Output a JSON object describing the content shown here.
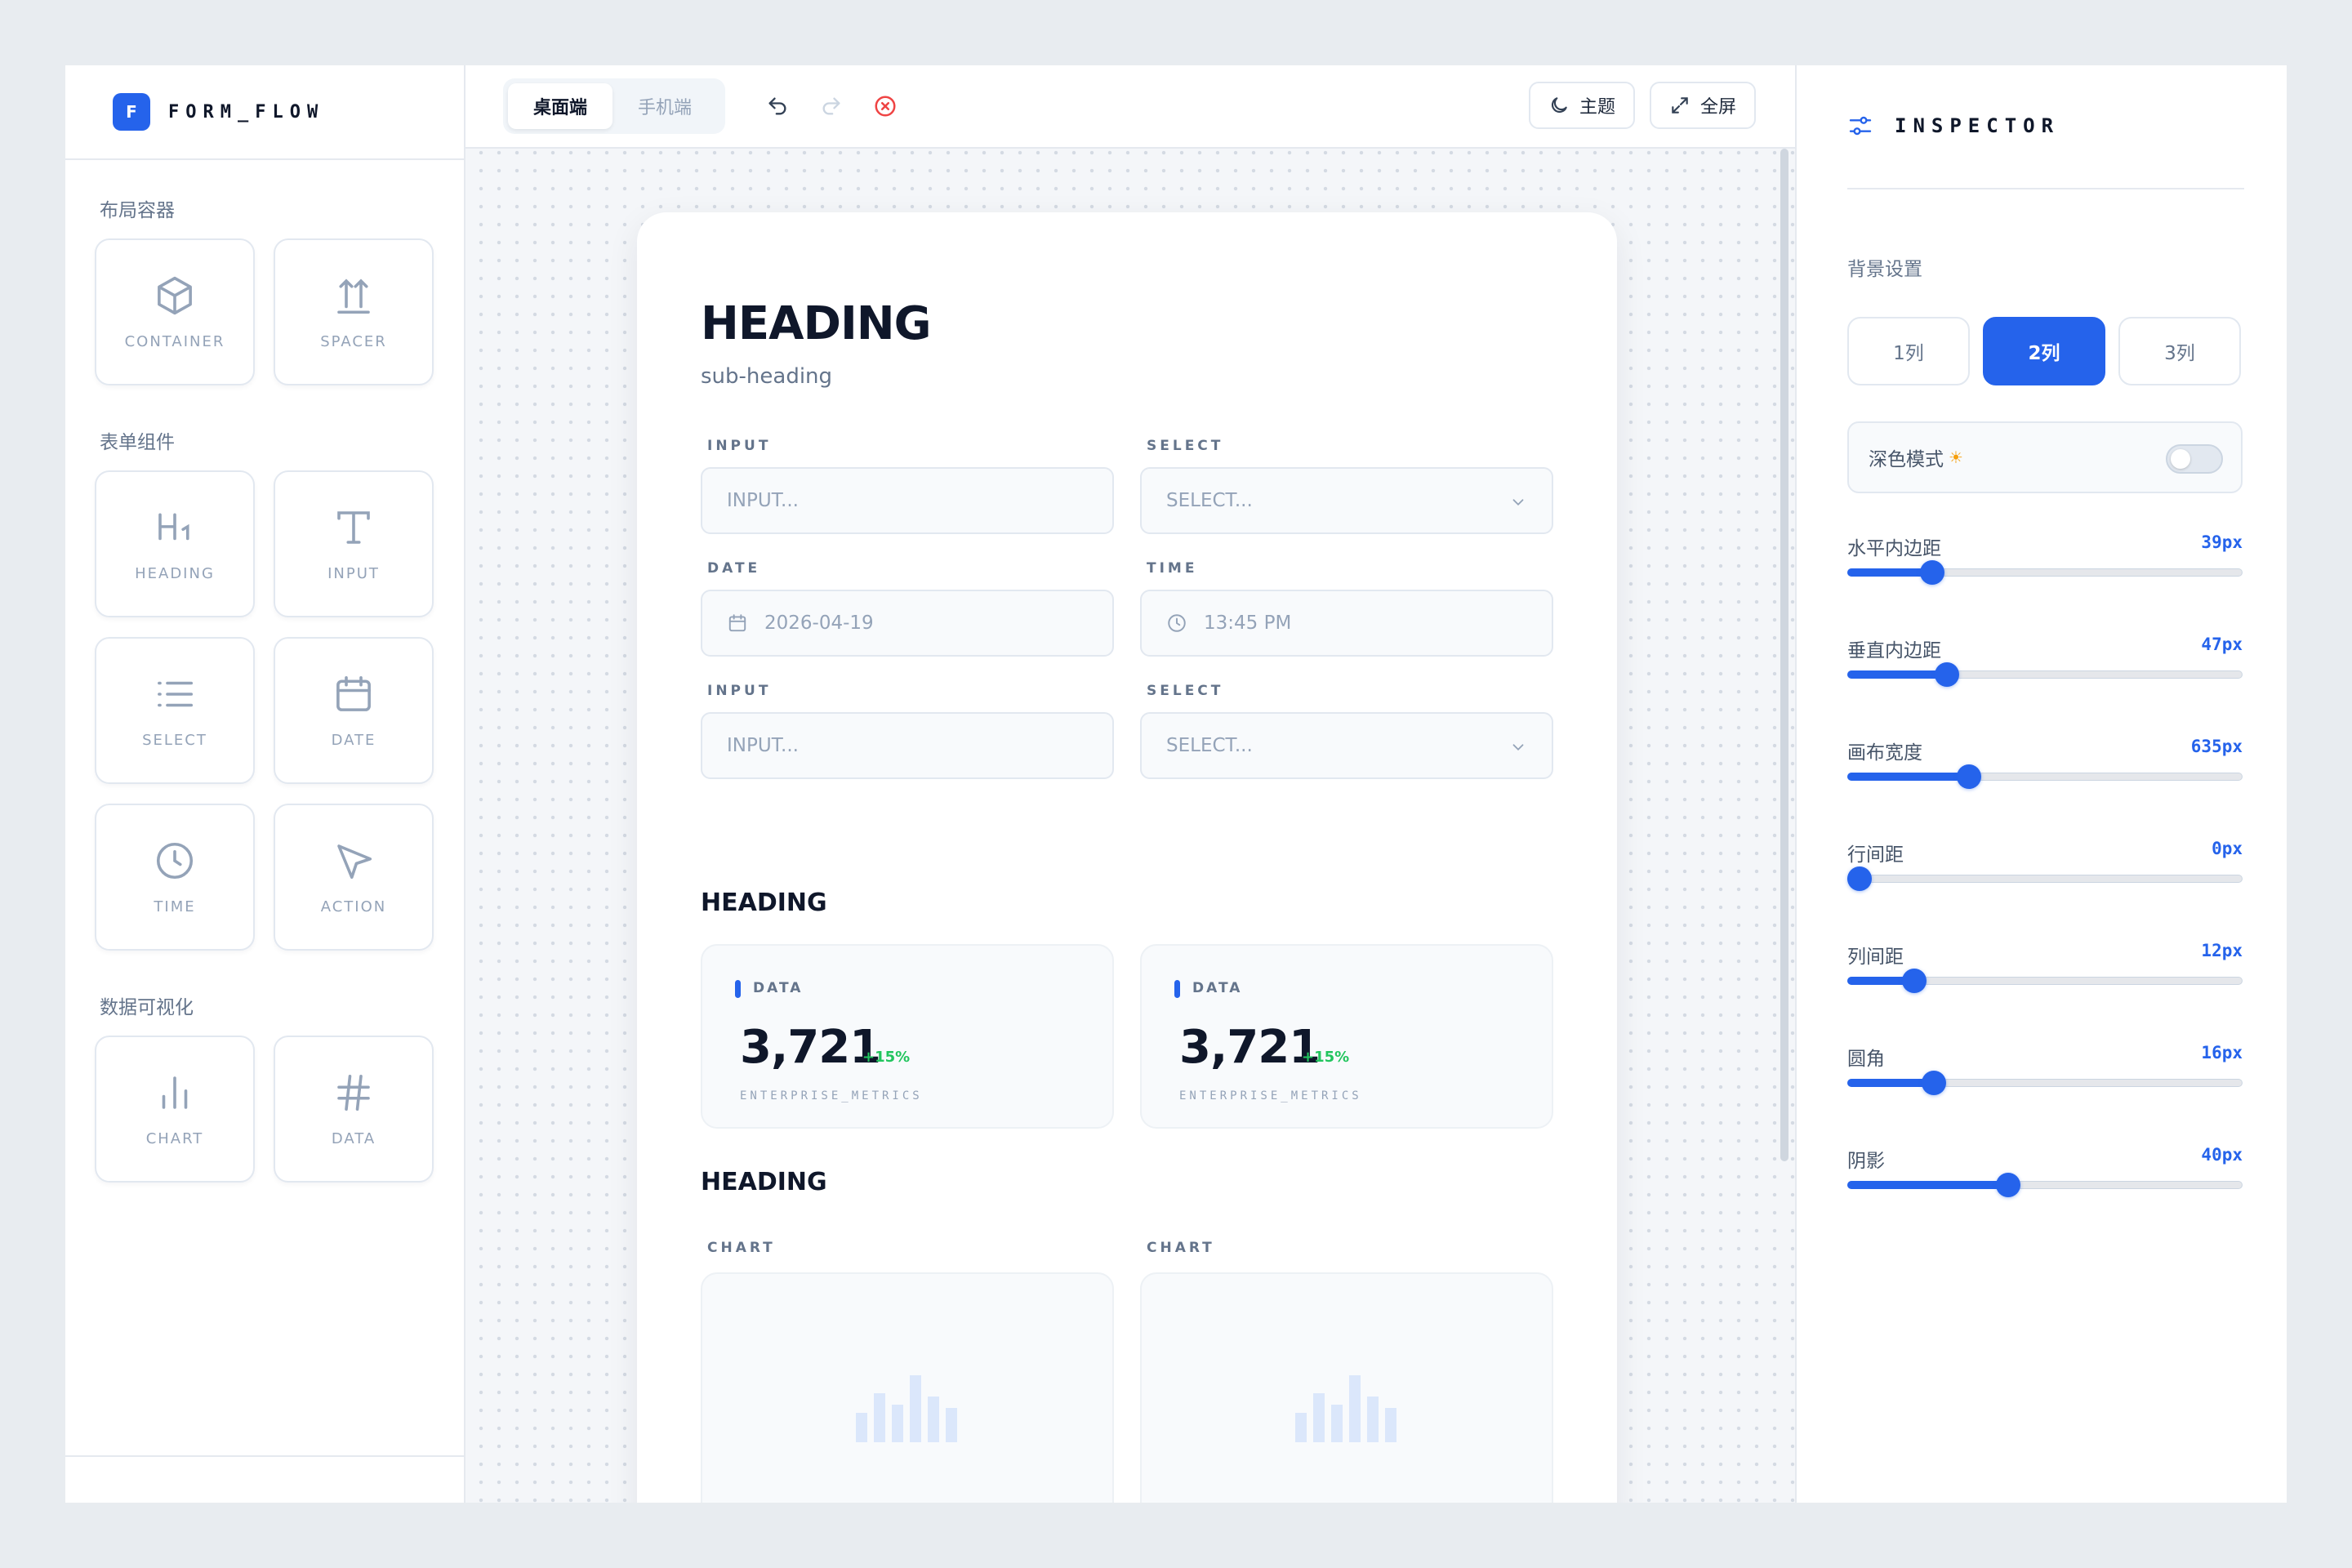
{
  "brand": {
    "logo_letter": "F",
    "name": "FORM_FLOW"
  },
  "palette": {
    "sections": [
      {
        "title": "布局容器",
        "items": [
          {
            "label": "CONTAINER",
            "icon": "box-icon"
          },
          {
            "label": "SPACER",
            "icon": "spacer-icon"
          }
        ]
      },
      {
        "title": "表单组件",
        "items": [
          {
            "label": "HEADING",
            "icon": "heading-icon"
          },
          {
            "label": "INPUT",
            "icon": "text-icon"
          },
          {
            "label": "SELECT",
            "icon": "list-icon"
          },
          {
            "label": "DATE",
            "icon": "calendar-icon"
          },
          {
            "label": "TIME",
            "icon": "clock-icon"
          },
          {
            "label": "ACTION",
            "icon": "cursor-icon"
          }
        ]
      },
      {
        "title": "数据可视化",
        "items": [
          {
            "label": "CHART",
            "icon": "bar-chart-icon"
          },
          {
            "label": "DATA",
            "icon": "hash-icon"
          }
        ]
      }
    ]
  },
  "toolbar": {
    "device_tabs": [
      {
        "label": "桌面端",
        "active": true
      },
      {
        "label": "手机端",
        "active": false
      }
    ],
    "theme_label": "主题",
    "fullscreen_label": "全屏"
  },
  "canvas": {
    "heading": "HEADING",
    "subheading": "sub-heading",
    "fields": [
      {
        "label": "INPUT",
        "placeholder": "INPUT..."
      },
      {
        "label": "SELECT",
        "placeholder": "SELECT..."
      },
      {
        "label": "DATE",
        "value": "2026-04-19"
      },
      {
        "label": "TIME",
        "value": "13:45 PM"
      },
      {
        "label": "INPUT",
        "placeholder": "INPUT..."
      },
      {
        "label": "SELECT",
        "placeholder": "SELECT..."
      }
    ],
    "section2_heading": "HEADING",
    "metrics": [
      {
        "label": "DATA",
        "value": "3,721",
        "delta": "+15%",
        "footer": "ENTERPRISE_METRICS"
      },
      {
        "label": "DATA",
        "value": "3,721",
        "delta": "+15%",
        "footer": "ENTERPRISE_METRICS"
      }
    ],
    "section3_heading": "HEADING",
    "charts": [
      {
        "label": "CHART"
      },
      {
        "label": "CHART"
      }
    ]
  },
  "inspector": {
    "title": "INSPECTOR",
    "background_label": "背景设置",
    "columns": [
      {
        "label": "1列",
        "active": false
      },
      {
        "label": "2列",
        "active": true
      },
      {
        "label": "3列",
        "active": false
      }
    ],
    "dark_mode_label": "深色模式",
    "dark_mode_glyph": "☀",
    "sliders": [
      {
        "label": "水平内边距",
        "value": "39px",
        "fraction": 0.215
      },
      {
        "label": "垂直内边距",
        "value": "47px",
        "fraction": 0.253
      },
      {
        "label": "画布宽度",
        "value": "635px",
        "fraction": 0.307
      },
      {
        "label": "行间距",
        "value": "0px",
        "fraction": 0.03
      },
      {
        "label": "列间距",
        "value": "12px",
        "fraction": 0.17
      },
      {
        "label": "圆角",
        "value": "16px",
        "fraction": 0.22
      },
      {
        "label": "阴影",
        "value": "40px",
        "fraction": 0.408
      }
    ]
  },
  "colors": {
    "accent": "#2563eb",
    "positive": "#22c55e",
    "danger": "#ef4444"
  }
}
